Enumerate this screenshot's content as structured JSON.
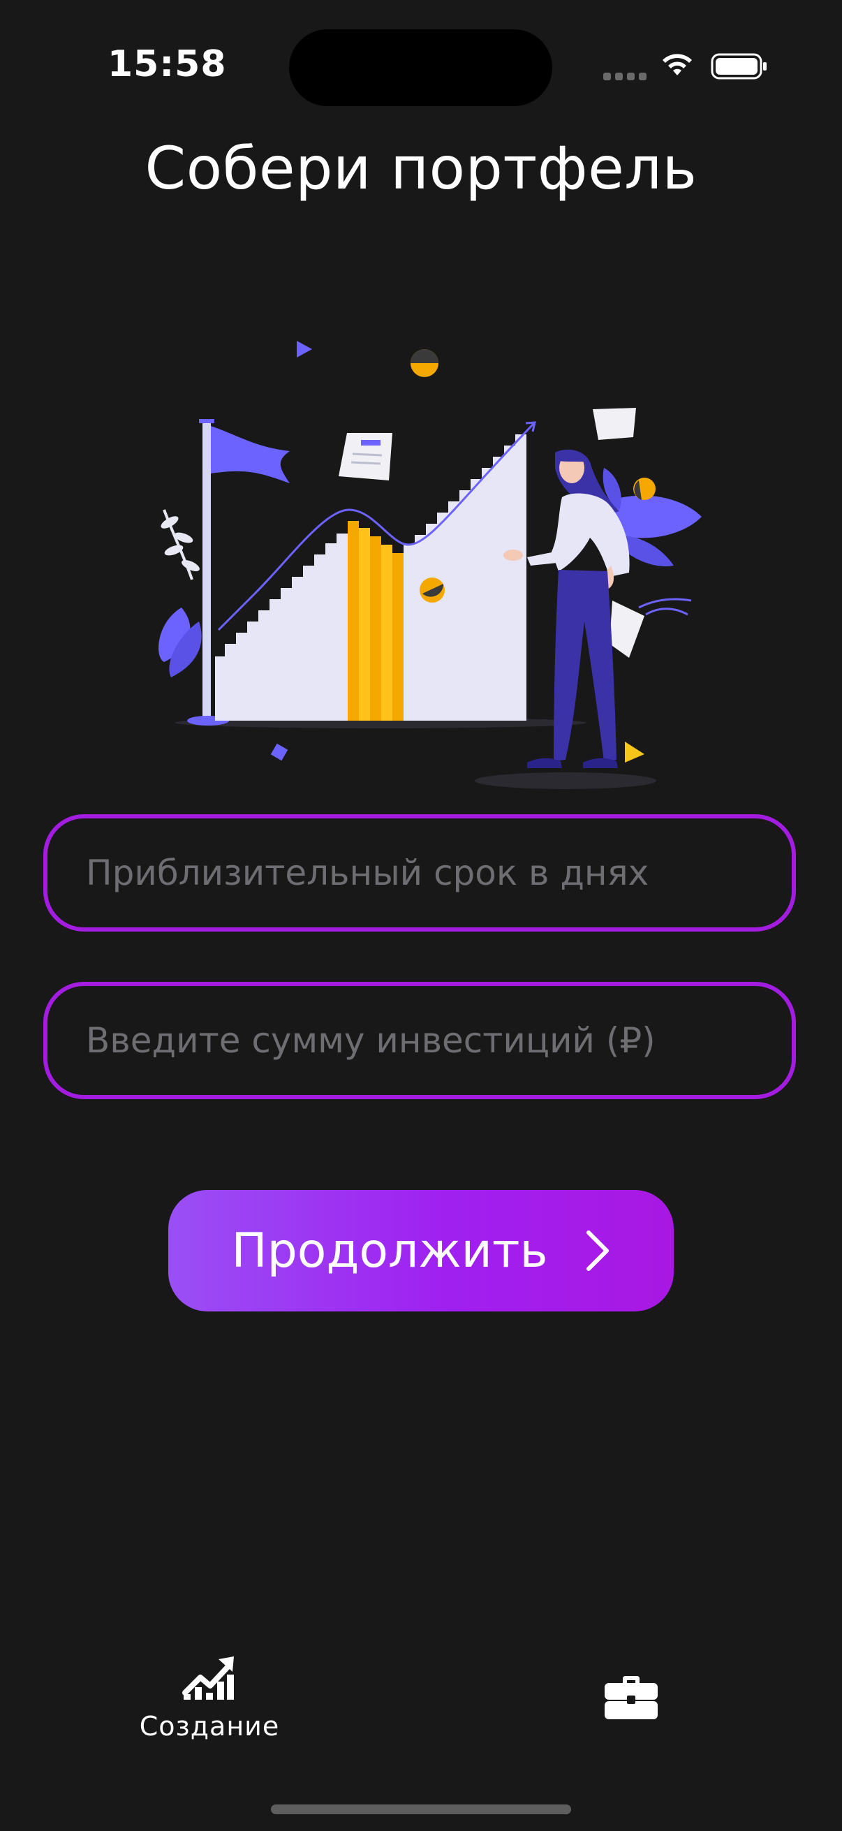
{
  "status_bar": {
    "time": "15:58"
  },
  "header": {
    "title": "Собери портфель"
  },
  "form": {
    "days_placeholder": "Приблизительный срок в днях",
    "days_value": "",
    "amount_placeholder": "Введите сумму инвестиций (₽)",
    "amount_value": "",
    "continue_label": "Продолжить"
  },
  "tab_bar": {
    "items": [
      {
        "label": "Создание",
        "icon": "chart-up-icon",
        "active": true
      },
      {
        "label": "",
        "icon": "briefcase-icon",
        "active": false
      }
    ]
  },
  "colors": {
    "background": "#181818",
    "accent_border": "#a21de0",
    "button_gradient_start": "#9a4ff5",
    "button_gradient_end": "#a918e3",
    "illustration_purple": "#6c63ff",
    "illustration_gold": "#f5a800"
  }
}
